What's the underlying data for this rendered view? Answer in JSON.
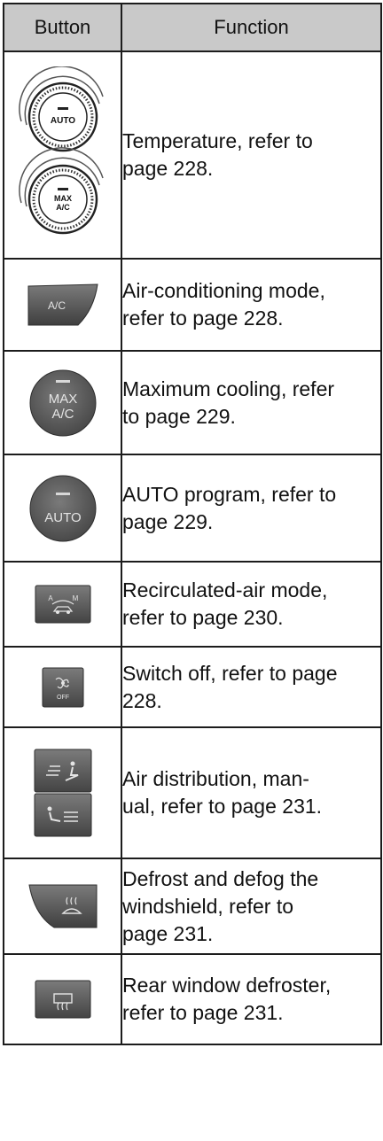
{
  "table": {
    "headers": {
      "button": "Button",
      "function": "Function"
    },
    "rows": [
      {
        "icon": "temperature-dial-icon",
        "line1": "Temperature, refer to",
        "line2": "page 228."
      },
      {
        "icon": "ac-button-icon",
        "line1": "Air-conditioning mode,",
        "line2": "refer to page 228."
      },
      {
        "icon": "max-ac-button-icon",
        "line1": "Maximum cooling, refer",
        "line2": "to page 229."
      },
      {
        "icon": "auto-button-icon",
        "line1": "AUTO program, refer to",
        "line2": "page 229."
      },
      {
        "icon": "recirculated-air-button-icon",
        "line1": "Recirculated-air mode,",
        "line2": "refer to page 230."
      },
      {
        "icon": "switch-off-button-icon",
        "line1": "Switch off, refer to page",
        "line2": "228."
      },
      {
        "icon": "air-distribution-buttons-icon",
        "line1": "Air distribution, man-",
        "line2": "ual, refer to page 231."
      },
      {
        "icon": "windshield-defrost-button-icon",
        "line1": "Defrost and defog the",
        "line2": "windshield, refer to",
        "line3": "page 231."
      },
      {
        "icon": "rear-defroster-button-icon",
        "line1": "Rear window defroster,",
        "line2": "refer to page 231."
      }
    ]
  },
  "icon_text": {
    "auto": "AUTO",
    "max": "MAX",
    "ac": "A/C",
    "a": "A",
    "m": "M",
    "off": "OFF"
  }
}
